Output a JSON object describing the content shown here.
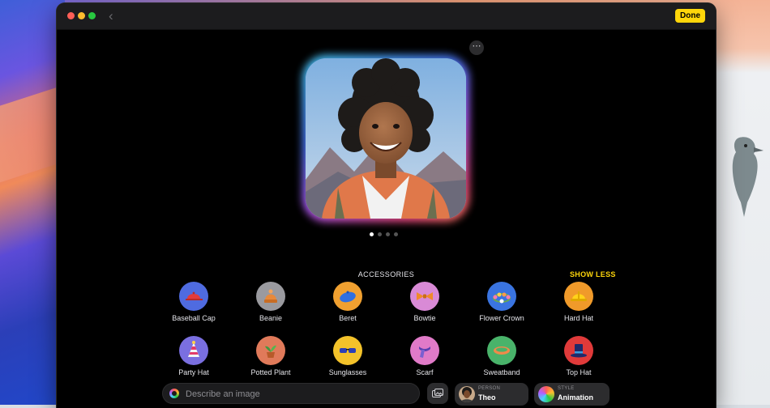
{
  "window": {
    "done_label": "Done"
  },
  "preview": {
    "page_count": 4,
    "active_page": 1
  },
  "accessories": {
    "title": "ACCESSORIES",
    "toggle_label": "SHOW LESS",
    "items": [
      {
        "label": "Baseball Cap",
        "icon": "baseball-cap-icon",
        "color": "#4f6be0"
      },
      {
        "label": "Beanie",
        "icon": "beanie-icon",
        "color": "#9a9a9f"
      },
      {
        "label": "Beret",
        "icon": "beret-icon",
        "color": "#f0a030"
      },
      {
        "label": "Bowtie",
        "icon": "bowtie-icon",
        "color": "#d98ad6"
      },
      {
        "label": "Flower Crown",
        "icon": "flower-crown-icon",
        "color": "#3a74e0"
      },
      {
        "label": "Hard Hat",
        "icon": "hard-hat-icon",
        "color": "#f09a2a"
      },
      {
        "label": "Party Hat",
        "icon": "party-hat-icon",
        "color": "#7a6fe0"
      },
      {
        "label": "Potted Plant",
        "icon": "potted-plant-icon",
        "color": "#e07a5a"
      },
      {
        "label": "Sunglasses",
        "icon": "sunglasses-icon",
        "color": "#f3c22a"
      },
      {
        "label": "Scarf",
        "icon": "scarf-icon",
        "color": "#e07ac8"
      },
      {
        "label": "Sweatband",
        "icon": "sweatband-icon",
        "color": "#49b36a"
      },
      {
        "label": "Top Hat",
        "icon": "top-hat-icon",
        "color": "#e03a3a"
      }
    ]
  },
  "bottom_bar": {
    "prompt_placeholder": "Describe an image",
    "person": {
      "kicker": "PERSON",
      "value": "Theo"
    },
    "style": {
      "kicker": "STYLE",
      "value": "Animation"
    }
  },
  "colors": {
    "accent": "#ffd60a",
    "window_bg": "#000000",
    "chrome": "#1c1c1e"
  }
}
